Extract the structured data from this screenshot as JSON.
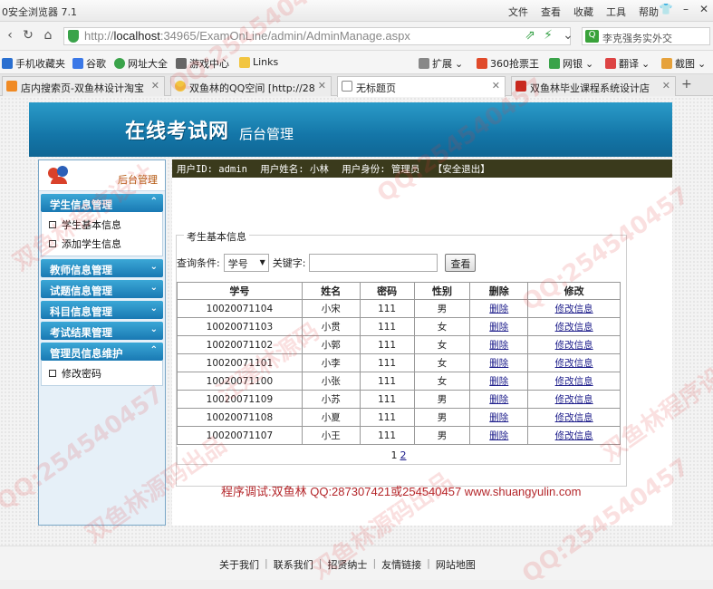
{
  "browser": {
    "title": "0安全浏览器 7.1",
    "menus": [
      "文件",
      "查看",
      "收藏",
      "工具",
      "帮助"
    ],
    "url_prefix": "http://",
    "url_host": "localhost",
    "url_rest": ":34965/ExamOnLine/admin/AdminManage.aspx",
    "search_placeholder": "李克强务实外交",
    "favorites": [
      "手机收藏夹",
      "谷歌",
      "网址大全",
      "游戏中心",
      "Links",
      "扩展",
      "360抢票王",
      "网银",
      "翻译",
      "截图"
    ],
    "tabs": [
      {
        "label": "店内搜索页-双鱼林设计淘宝"
      },
      {
        "label": "双鱼林的QQ空间 [http://28"
      },
      {
        "label": "无标题页"
      },
      {
        "label": "双鱼林毕业课程系统设计店"
      }
    ]
  },
  "banner": {
    "logo": "在线考试网",
    "subtitle": "后台管理"
  },
  "sidebar": {
    "header_label": "后台管理",
    "sections": [
      {
        "title": "学生信息管理",
        "chevron": "⌃",
        "items": [
          "学生基本信息",
          "添加学生信息"
        ]
      },
      {
        "title": "教师信息管理",
        "chevron": "⌄",
        "items": []
      },
      {
        "title": "试题信息管理",
        "chevron": "⌄",
        "items": []
      },
      {
        "title": "科目信息管理",
        "chevron": "⌄",
        "items": []
      },
      {
        "title": "考试结果管理",
        "chevron": "⌄",
        "items": []
      },
      {
        "title": "管理员信息维护",
        "chevron": "⌃",
        "items": [
          "修改密码"
        ]
      }
    ]
  },
  "userbar": {
    "user_id": "用户ID: admin",
    "user_name": "用户姓名: 小林",
    "user_role": "用户身份: 管理员",
    "logout": "【安全退出】"
  },
  "query": {
    "legend": "考生基本信息",
    "condition_label": "查询条件:",
    "condition_value": "学号",
    "keyword_label": "关键字:",
    "keyword_value": "",
    "search_button": "查看"
  },
  "table": {
    "headers": [
      "学号",
      "姓名",
      "密码",
      "性别",
      "删除",
      "修改"
    ],
    "rows": [
      {
        "id": "10020071104",
        "name": "小宋",
        "pwd": "111",
        "sex": "男",
        "del": "删除",
        "edit": "修改信息"
      },
      {
        "id": "10020071103",
        "name": "小贯",
        "pwd": "111",
        "sex": "女",
        "del": "删除",
        "edit": "修改信息"
      },
      {
        "id": "10020071102",
        "name": "小郭",
        "pwd": "111",
        "sex": "女",
        "del": "删除",
        "edit": "修改信息"
      },
      {
        "id": "10020071101",
        "name": "小李",
        "pwd": "111",
        "sex": "女",
        "del": "删除",
        "edit": "修改信息"
      },
      {
        "id": "10020071100",
        "name": "小张",
        "pwd": "111",
        "sex": "女",
        "del": "删除",
        "edit": "修改信息"
      },
      {
        "id": "10020071109",
        "name": "小苏",
        "pwd": "111",
        "sex": "男",
        "del": "删除",
        "edit": "修改信息"
      },
      {
        "id": "10020071108",
        "name": "小夏",
        "pwd": "111",
        "sex": "男",
        "del": "删除",
        "edit": "修改信息"
      },
      {
        "id": "10020071107",
        "name": "小王",
        "pwd": "111",
        "sex": "男",
        "del": "删除",
        "edit": "修改信息"
      }
    ],
    "pager_current": "1",
    "pager_next": "2"
  },
  "credit": "程序调试:双鱼林 QQ:287307421或254540457 www.shuangyulin.com",
  "footer": {
    "links": [
      "关于我们",
      "联系我们",
      "招贤纳士",
      "友情链接",
      "网站地图"
    ]
  },
  "watermarks": [
    "QQ:254540457",
    "双鱼林程序设计",
    "汪建林源码",
    "双鱼林源码出品"
  ],
  "colors": {
    "banner": "#1476a8",
    "menu_header": "#1979b3",
    "userbar": "#3a3a1c",
    "credit": "#b4262a",
    "link": "#1c1c8a"
  }
}
